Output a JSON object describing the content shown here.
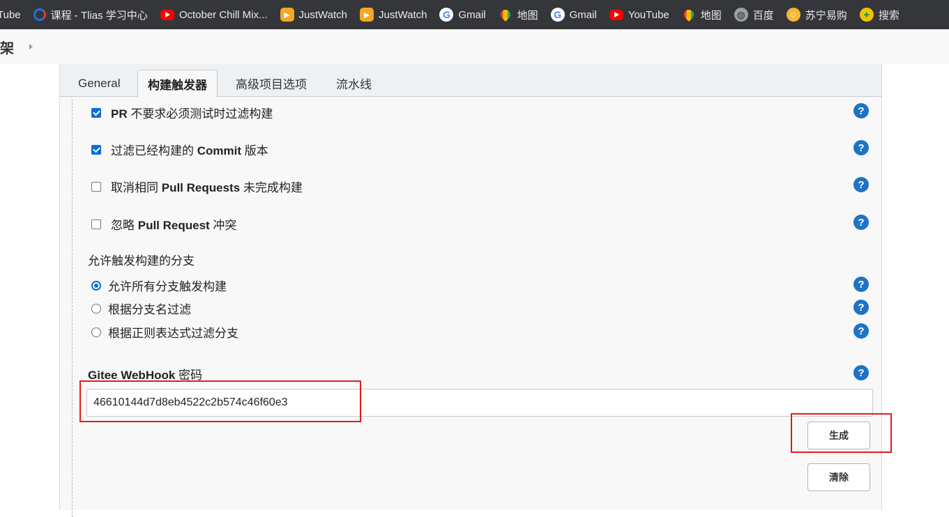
{
  "bookmarks": [
    {
      "label": "Tube",
      "icon": "partial-text"
    },
    {
      "label": "课程 - Tlias 学习中心",
      "icon": "tlias-icon"
    },
    {
      "label": "October Chill Mix...",
      "icon": "youtube-icon"
    },
    {
      "label": "JustWatch",
      "icon": "justwatch-icon"
    },
    {
      "label": "JustWatch",
      "icon": "justwatch-icon"
    },
    {
      "label": "Gmail",
      "icon": "google-icon"
    },
    {
      "label": "地图",
      "icon": "maps-icon"
    },
    {
      "label": "Gmail",
      "icon": "google-icon"
    },
    {
      "label": "YouTube",
      "icon": "youtube-icon"
    },
    {
      "label": "地图",
      "icon": "maps-icon"
    },
    {
      "label": "百度",
      "icon": "globe-icon"
    },
    {
      "label": "苏宁易购",
      "icon": "suning-icon"
    },
    {
      "label": "搜索",
      "icon": "search-plus-icon"
    }
  ],
  "breadcrumb": {
    "text": "架"
  },
  "tabs": [
    {
      "label": "General",
      "active": false
    },
    {
      "label": "构建触发器",
      "active": true
    },
    {
      "label": "高级项目选项",
      "active": false
    },
    {
      "label": "流水线",
      "active": false
    }
  ],
  "checkboxes": [
    {
      "pre": "",
      "bold": "PR",
      "post": " 不要求必须测试时过滤构建",
      "checked": true
    },
    {
      "pre": "过滤已经构建的 ",
      "bold": "Commit",
      "post": " 版本",
      "checked": true
    },
    {
      "pre": "取消相同 ",
      "bold": "Pull Requests",
      "post": " 未完成构建",
      "checked": false
    },
    {
      "pre": "忽略 ",
      "bold": "Pull Request",
      "post": " 冲突",
      "checked": false
    }
  ],
  "branch_section": {
    "label": "允许触发构建的分支",
    "options": [
      {
        "label": "允许所有分支触发构建",
        "selected": true
      },
      {
        "label": "根据分支名过滤",
        "selected": false
      },
      {
        "label": "根据正则表达式过滤分支",
        "selected": false
      }
    ]
  },
  "webhook": {
    "label_bold": "Gitee WebHook",
    "label_rest": " 密码",
    "value": "46610144d7d8eb4522c2b574c46f60e3"
  },
  "buttons": {
    "generate": "生成",
    "clear": "清除"
  },
  "help_glyph": "?",
  "colors": {
    "accent": "#0a6fd8",
    "help": "#1f73c4",
    "highlight": "#e01b1b"
  }
}
